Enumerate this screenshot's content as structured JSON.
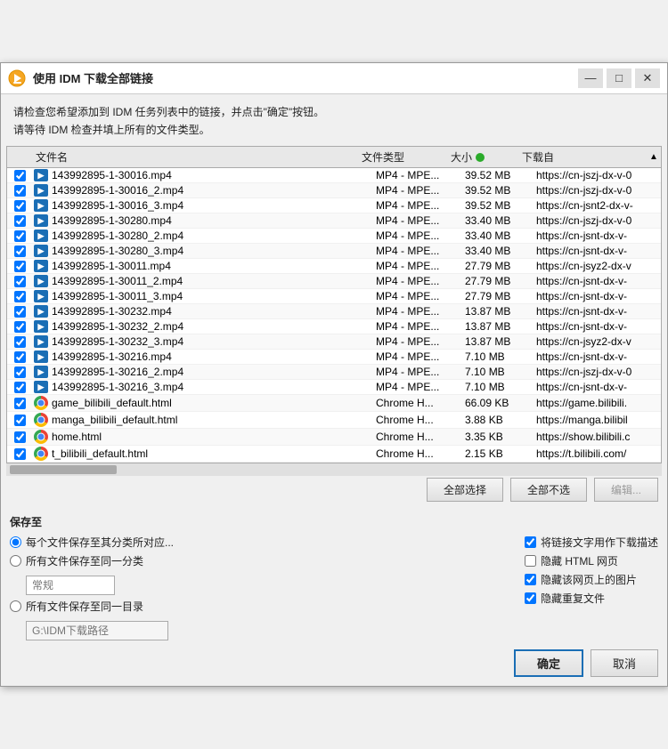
{
  "window": {
    "title": "使用 IDM 下载全部链接",
    "minimize_label": "—",
    "maximize_label": "□",
    "close_label": "✕"
  },
  "desc": {
    "line1": "请检查您希望添加到 IDM 任务列表中的链接，并点击\"确定\"按钮。",
    "line2": "请等待 IDM 检查并填上所有的文件类型。"
  },
  "table": {
    "headers": {
      "name": "文件名",
      "type": "文件类型",
      "size": "大小",
      "from": "下载自"
    },
    "rows": [
      {
        "type": "mp4",
        "name": "143992895-1-30016.mp4",
        "filetype": "MP4 - MPE...",
        "size": "39.52  MB",
        "from": "https://cn-jszj-dx-v-0"
      },
      {
        "type": "mp4",
        "name": "143992895-1-30016_2.mp4",
        "filetype": "MP4 - MPE...",
        "size": "39.52  MB",
        "from": "https://cn-jszj-dx-v-0"
      },
      {
        "type": "mp4",
        "name": "143992895-1-30016_3.mp4",
        "filetype": "MP4 - MPE...",
        "size": "39.52  MB",
        "from": "https://cn-jsnt2-dx-v-"
      },
      {
        "type": "mp4",
        "name": "143992895-1-30280.mp4",
        "filetype": "MP4 - MPE...",
        "size": "33.40  MB",
        "from": "https://cn-jszj-dx-v-0"
      },
      {
        "type": "mp4",
        "name": "143992895-1-30280_2.mp4",
        "filetype": "MP4 - MPE...",
        "size": "33.40  MB",
        "from": "https://cn-jsnt-dx-v-"
      },
      {
        "type": "mp4",
        "name": "143992895-1-30280_3.mp4",
        "filetype": "MP4 - MPE...",
        "size": "33.40  MB",
        "from": "https://cn-jsnt-dx-v-"
      },
      {
        "type": "mp4",
        "name": "143992895-1-30011.mp4",
        "filetype": "MP4 - MPE...",
        "size": "27.79  MB",
        "from": "https://cn-jsyz2-dx-v"
      },
      {
        "type": "mp4",
        "name": "143992895-1-30011_2.mp4",
        "filetype": "MP4 - MPE...",
        "size": "27.79  MB",
        "from": "https://cn-jsnt-dx-v-"
      },
      {
        "type": "mp4",
        "name": "143992895-1-30011_3.mp4",
        "filetype": "MP4 - MPE...",
        "size": "27.79  MB",
        "from": "https://cn-jsnt-dx-v-"
      },
      {
        "type": "mp4",
        "name": "143992895-1-30232.mp4",
        "filetype": "MP4 - MPE...",
        "size": "13.87  MB",
        "from": "https://cn-jsnt-dx-v-"
      },
      {
        "type": "mp4",
        "name": "143992895-1-30232_2.mp4",
        "filetype": "MP4 - MPE...",
        "size": "13.87  MB",
        "from": "https://cn-jsnt-dx-v-"
      },
      {
        "type": "mp4",
        "name": "143992895-1-30232_3.mp4",
        "filetype": "MP4 - MPE...",
        "size": "13.87  MB",
        "from": "https://cn-jsyz2-dx-v"
      },
      {
        "type": "mp4",
        "name": "143992895-1-30216.mp4",
        "filetype": "MP4 - MPE...",
        "size": "7.10  MB",
        "from": "https://cn-jsnt-dx-v-"
      },
      {
        "type": "mp4",
        "name": "143992895-1-30216_2.mp4",
        "filetype": "MP4 - MPE...",
        "size": "7.10  MB",
        "from": "https://cn-jszj-dx-v-0"
      },
      {
        "type": "mp4",
        "name": "143992895-1-30216_3.mp4",
        "filetype": "MP4 - MPE...",
        "size": "7.10  MB",
        "from": "https://cn-jsnt-dx-v-"
      },
      {
        "type": "chrome",
        "name": "game_bilibili_default.html",
        "filetype": "Chrome H...",
        "size": "66.09  KB",
        "from": "https://game.bilibili."
      },
      {
        "type": "chrome",
        "name": "manga_bilibili_default.html",
        "filetype": "Chrome H...",
        "size": "3.88  KB",
        "from": "https://manga.bilibil"
      },
      {
        "type": "chrome",
        "name": "home.html",
        "filetype": "Chrome H...",
        "size": "3.35  KB",
        "from": "https://show.bilibili.c"
      },
      {
        "type": "chrome",
        "name": "t_bilibili_default.html",
        "filetype": "Chrome H...",
        "size": "2.15  KB",
        "from": "https://t.bilibili.com/"
      }
    ]
  },
  "action_buttons": {
    "select_all": "全部选择",
    "deselect_all": "全部不选",
    "edit": "编辑..."
  },
  "save_to": {
    "label": "保存至",
    "options": [
      "每个文件保存至其分类所对应...",
      "所有文件保存至同一分类",
      "所有文件保存至同一目录"
    ],
    "normal_label": "常规",
    "path_placeholder": "G:\\IDM下载路径"
  },
  "checkboxes": {
    "use_link_text": "将链接文字用作下载描述",
    "hide_html": "隐藏 HTML 网页",
    "hide_images": "隐藏该网页上的图片",
    "hide_duplicate": "隐藏重复文件"
  },
  "confirm": "确定",
  "cancel": "取消"
}
